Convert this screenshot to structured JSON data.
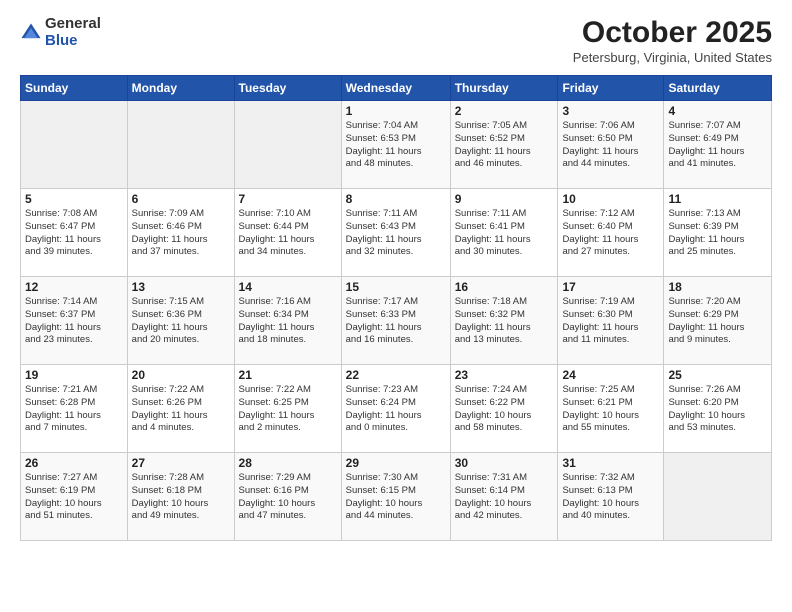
{
  "header": {
    "logo_general": "General",
    "logo_blue": "Blue",
    "month_title": "October 2025",
    "location": "Petersburg, Virginia, United States"
  },
  "weekdays": [
    "Sunday",
    "Monday",
    "Tuesday",
    "Wednesday",
    "Thursday",
    "Friday",
    "Saturday"
  ],
  "weeks": [
    [
      {
        "day": "",
        "info": ""
      },
      {
        "day": "",
        "info": ""
      },
      {
        "day": "",
        "info": ""
      },
      {
        "day": "1",
        "info": "Sunrise: 7:04 AM\nSunset: 6:53 PM\nDaylight: 11 hours\nand 48 minutes."
      },
      {
        "day": "2",
        "info": "Sunrise: 7:05 AM\nSunset: 6:52 PM\nDaylight: 11 hours\nand 46 minutes."
      },
      {
        "day": "3",
        "info": "Sunrise: 7:06 AM\nSunset: 6:50 PM\nDaylight: 11 hours\nand 44 minutes."
      },
      {
        "day": "4",
        "info": "Sunrise: 7:07 AM\nSunset: 6:49 PM\nDaylight: 11 hours\nand 41 minutes."
      }
    ],
    [
      {
        "day": "5",
        "info": "Sunrise: 7:08 AM\nSunset: 6:47 PM\nDaylight: 11 hours\nand 39 minutes."
      },
      {
        "day": "6",
        "info": "Sunrise: 7:09 AM\nSunset: 6:46 PM\nDaylight: 11 hours\nand 37 minutes."
      },
      {
        "day": "7",
        "info": "Sunrise: 7:10 AM\nSunset: 6:44 PM\nDaylight: 11 hours\nand 34 minutes."
      },
      {
        "day": "8",
        "info": "Sunrise: 7:11 AM\nSunset: 6:43 PM\nDaylight: 11 hours\nand 32 minutes."
      },
      {
        "day": "9",
        "info": "Sunrise: 7:11 AM\nSunset: 6:41 PM\nDaylight: 11 hours\nand 30 minutes."
      },
      {
        "day": "10",
        "info": "Sunrise: 7:12 AM\nSunset: 6:40 PM\nDaylight: 11 hours\nand 27 minutes."
      },
      {
        "day": "11",
        "info": "Sunrise: 7:13 AM\nSunset: 6:39 PM\nDaylight: 11 hours\nand 25 minutes."
      }
    ],
    [
      {
        "day": "12",
        "info": "Sunrise: 7:14 AM\nSunset: 6:37 PM\nDaylight: 11 hours\nand 23 minutes."
      },
      {
        "day": "13",
        "info": "Sunrise: 7:15 AM\nSunset: 6:36 PM\nDaylight: 11 hours\nand 20 minutes."
      },
      {
        "day": "14",
        "info": "Sunrise: 7:16 AM\nSunset: 6:34 PM\nDaylight: 11 hours\nand 18 minutes."
      },
      {
        "day": "15",
        "info": "Sunrise: 7:17 AM\nSunset: 6:33 PM\nDaylight: 11 hours\nand 16 minutes."
      },
      {
        "day": "16",
        "info": "Sunrise: 7:18 AM\nSunset: 6:32 PM\nDaylight: 11 hours\nand 13 minutes."
      },
      {
        "day": "17",
        "info": "Sunrise: 7:19 AM\nSunset: 6:30 PM\nDaylight: 11 hours\nand 11 minutes."
      },
      {
        "day": "18",
        "info": "Sunrise: 7:20 AM\nSunset: 6:29 PM\nDaylight: 11 hours\nand 9 minutes."
      }
    ],
    [
      {
        "day": "19",
        "info": "Sunrise: 7:21 AM\nSunset: 6:28 PM\nDaylight: 11 hours\nand 7 minutes."
      },
      {
        "day": "20",
        "info": "Sunrise: 7:22 AM\nSunset: 6:26 PM\nDaylight: 11 hours\nand 4 minutes."
      },
      {
        "day": "21",
        "info": "Sunrise: 7:22 AM\nSunset: 6:25 PM\nDaylight: 11 hours\nand 2 minutes."
      },
      {
        "day": "22",
        "info": "Sunrise: 7:23 AM\nSunset: 6:24 PM\nDaylight: 11 hours\nand 0 minutes."
      },
      {
        "day": "23",
        "info": "Sunrise: 7:24 AM\nSunset: 6:22 PM\nDaylight: 10 hours\nand 58 minutes."
      },
      {
        "day": "24",
        "info": "Sunrise: 7:25 AM\nSunset: 6:21 PM\nDaylight: 10 hours\nand 55 minutes."
      },
      {
        "day": "25",
        "info": "Sunrise: 7:26 AM\nSunset: 6:20 PM\nDaylight: 10 hours\nand 53 minutes."
      }
    ],
    [
      {
        "day": "26",
        "info": "Sunrise: 7:27 AM\nSunset: 6:19 PM\nDaylight: 10 hours\nand 51 minutes."
      },
      {
        "day": "27",
        "info": "Sunrise: 7:28 AM\nSunset: 6:18 PM\nDaylight: 10 hours\nand 49 minutes."
      },
      {
        "day": "28",
        "info": "Sunrise: 7:29 AM\nSunset: 6:16 PM\nDaylight: 10 hours\nand 47 minutes."
      },
      {
        "day": "29",
        "info": "Sunrise: 7:30 AM\nSunset: 6:15 PM\nDaylight: 10 hours\nand 44 minutes."
      },
      {
        "day": "30",
        "info": "Sunrise: 7:31 AM\nSunset: 6:14 PM\nDaylight: 10 hours\nand 42 minutes."
      },
      {
        "day": "31",
        "info": "Sunrise: 7:32 AM\nSunset: 6:13 PM\nDaylight: 10 hours\nand 40 minutes."
      },
      {
        "day": "",
        "info": ""
      }
    ]
  ]
}
